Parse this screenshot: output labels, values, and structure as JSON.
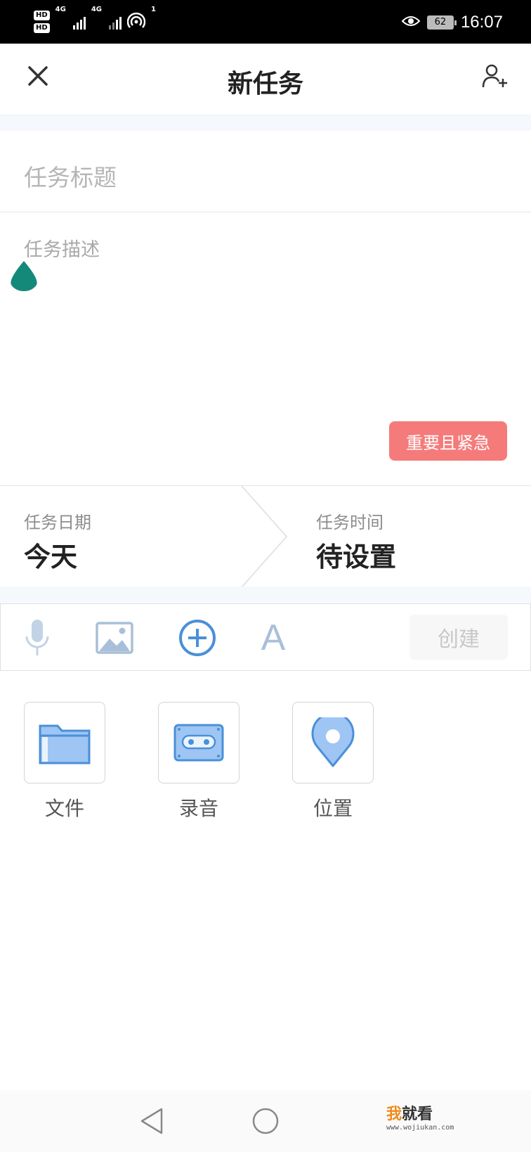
{
  "status_bar": {
    "time": "16:07",
    "battery": "62",
    "sim1_badge": "HD",
    "sim2_badge": "HD",
    "network_1": "4G",
    "network_2": "4G",
    "hotspot_count": "1"
  },
  "header": {
    "title": "新任务",
    "close_icon": "close-icon",
    "add_member_icon": "add-user-icon"
  },
  "form": {
    "title_placeholder": "任务标题",
    "description_placeholder": "任务描述",
    "priority_label": "重要且紧急",
    "priority_color": "#f57b7b"
  },
  "schedule": {
    "date_label": "任务日期",
    "date_value": "今天",
    "time_label": "任务时间",
    "time_value": "待设置"
  },
  "toolbar": {
    "icons": [
      "microphone-icon",
      "image-icon",
      "plus-circle-icon",
      "text-format-icon"
    ],
    "text_icon_glyph": "A",
    "create_label": "创建",
    "accent_color": "#4a90d9"
  },
  "attachments": [
    {
      "label": "文件",
      "icon": "folder-icon"
    },
    {
      "label": "录音",
      "icon": "tape-icon"
    },
    {
      "label": "位置",
      "icon": "location-pin-icon"
    }
  ],
  "watermark": {
    "brand_highlight": "我",
    "brand_rest": "就看",
    "url": "www.wojiukan.com"
  }
}
